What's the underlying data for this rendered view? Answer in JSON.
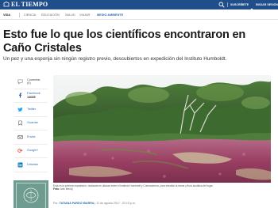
{
  "topbar": {
    "logo": "EL TIEMPO",
    "subscribe": "SUSCRÍBETE",
    "login": "INICIAR SESIÓN",
    "colors": {
      "bar": "#1f4e8a",
      "accent": "#2b6cb5"
    }
  },
  "nav": {
    "items": [
      "VIDA",
      "CIENCIA",
      "EDUCACIÓN",
      "SALUD",
      "VIAJAR",
      "MEDIO AMBIENTE"
    ],
    "active": "MEDIO AMBIENTE"
  },
  "article": {
    "title": "Esto fue lo que los científicos encontraron en Caño Cristales",
    "lead": "Un pez y una esponja sin ningún registro previo, descubiertos en expedición del Instituto Humboldt.",
    "caption_line1": "Esta es la primera expedición, realizada en alianza entre el Instituto Humboldt y Cormacarena, para estudiar la fauna y flora acuática del lugar.",
    "caption_credit_label": "Foto:",
    "caption_credit": "Iván Mendj",
    "byline_prefix": "Por:",
    "byline_author": "TATIANA PARDO IBARRA",
    "byline_sep": "|",
    "byline_date": "11 de agosto 2017 , 02:15 p.m."
  },
  "social": [
    {
      "label": "Comentar",
      "sub": "(0)",
      "icon": "comment-icon"
    },
    {
      "label": "Facebook",
      "sub": "14085",
      "icon": "facebook-icon"
    },
    {
      "label": "Twitter",
      "sub": "",
      "icon": "twitter-icon"
    },
    {
      "label": "Guardar",
      "sub": "",
      "icon": "bookmark-icon"
    },
    {
      "label": "Enviar",
      "sub": "",
      "icon": "mail-icon"
    },
    {
      "label": "Google+",
      "sub": "",
      "icon": "googleplus-icon"
    },
    {
      "label": "Linkedin",
      "sub": "",
      "icon": "linkedin-icon"
    }
  ]
}
